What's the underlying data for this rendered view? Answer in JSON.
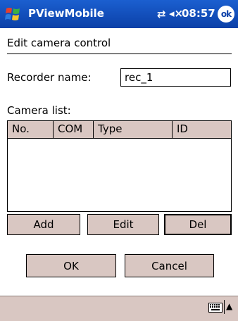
{
  "titlebar": {
    "app_title": "PViewMobile",
    "time": "08:57",
    "ok_label": "ok",
    "icons": [
      "windows-start-icon",
      "connectivity-icon",
      "volume-mute-icon"
    ]
  },
  "page": {
    "title": "Edit camera control"
  },
  "recorder": {
    "label": "Recorder name:",
    "value": "rec_1"
  },
  "camera_list": {
    "label": "Camera list:",
    "columns": [
      "No.",
      "COM",
      "Type",
      "ID"
    ],
    "rows": []
  },
  "buttons": {
    "add": "Add",
    "edit": "Edit",
    "del": "Del",
    "ok": "OK",
    "cancel": "Cancel"
  },
  "bottombar": {
    "icons": [
      "keyboard-icon",
      "up-arrow-icon"
    ]
  },
  "colors": {
    "titlebar": "#0b40a8",
    "button_face": "#d9c7c2"
  }
}
